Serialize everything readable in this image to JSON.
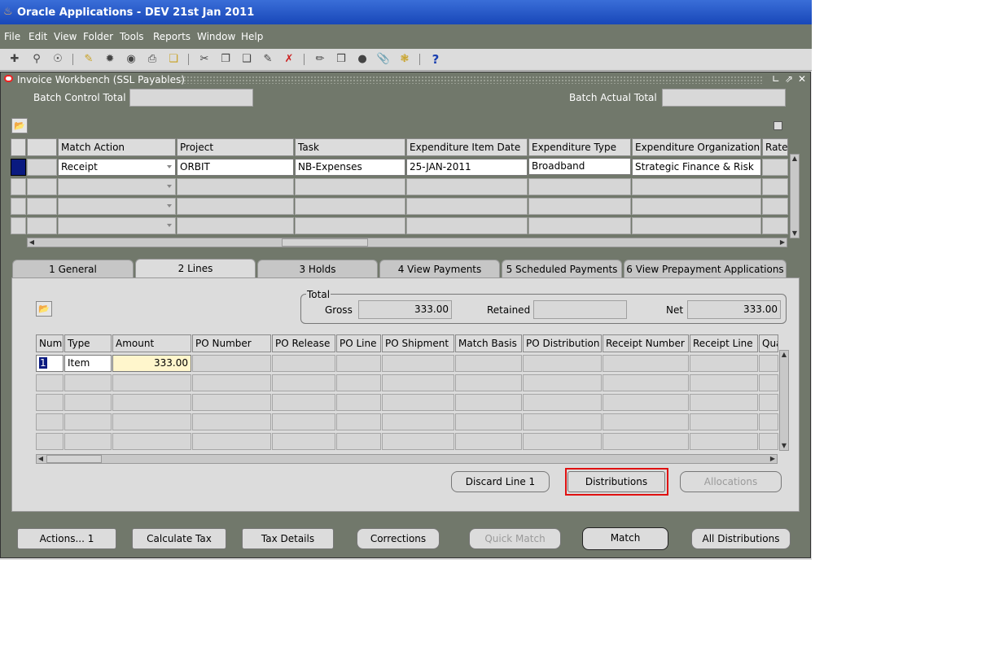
{
  "window": {
    "title": "Oracle Applications - DEV 21st Jan 2011"
  },
  "menu": [
    "File",
    "Edit",
    "View",
    "Folder",
    "Tools",
    "Reports",
    "Window",
    "Help"
  ],
  "toolbar": {
    "icons": [
      "new-icon",
      "find-icon",
      "navigator-icon",
      "save-icon",
      "next-step-icon",
      "switch-responsibility-icon",
      "print-icon",
      "close-form-icon",
      "cut-icon",
      "copy-icon",
      "paste-icon",
      "clear-record-icon",
      "delete-record-icon",
      "edit-field-icon",
      "zoom-icon",
      "translations-icon",
      "attachments-icon",
      "folder-tools-icon",
      "help-icon"
    ],
    "help_glyph": "?"
  },
  "form": {
    "title": "Invoice Workbench (SSL Payables)",
    "batch_control_total_label": "Batch Control Total",
    "batch_control_total_value": "",
    "batch_actual_total_label": "Batch Actual Total",
    "batch_actual_total_value": ""
  },
  "upper_table": {
    "headers": [
      "Match Action",
      "Project",
      "Task",
      "Expenditure Item Date",
      "Expenditure Type",
      "Expenditure Organization",
      "Rate"
    ],
    "row": {
      "match_action": "Receipt",
      "project": "ORBIT",
      "task": "NB-Expenses",
      "expenditure_item_date": "25-JAN-2011",
      "expenditure_type": "Broadband",
      "expenditure_organization": "Strategic Finance & Risk"
    }
  },
  "tabs": [
    {
      "label": "1 General"
    },
    {
      "label": "2 Lines",
      "active": true
    },
    {
      "label": "3 Holds"
    },
    {
      "label": "4 View Payments"
    },
    {
      "label": "5 Scheduled Payments"
    },
    {
      "label": "6 View Prepayment Applications"
    }
  ],
  "totals": {
    "group_label": "Total",
    "gross_label": "Gross",
    "gross_value": "333.00",
    "retained_label": "Retained",
    "retained_value": "",
    "net_label": "Net",
    "net_value": "333.00"
  },
  "lines_table": {
    "headers": [
      "Num",
      "Type",
      "Amount",
      "PO Number",
      "PO Release",
      "PO Line",
      "PO Shipment",
      "Match Basis",
      "PO Distribution",
      "Receipt Number",
      "Receipt Line",
      "Qua"
    ],
    "row": {
      "num": "1",
      "type": "Item",
      "amount": "333.00"
    }
  },
  "panel_buttons": {
    "discard_line": "Discard Line 1",
    "distributions": "Distributions",
    "allocations": "Allocations"
  },
  "bottom_buttons": {
    "actions": "Actions... 1",
    "calculate_tax": "Calculate Tax",
    "tax_details": "Tax Details",
    "corrections": "Corrections",
    "quick_match": "Quick Match",
    "match": "Match",
    "all_distributions": "All Distributions"
  },
  "colors": {
    "menubar": "#71786b",
    "titlebar": "#1847b8",
    "highlight": "#e01010",
    "amount_field": "#fff6cc"
  }
}
